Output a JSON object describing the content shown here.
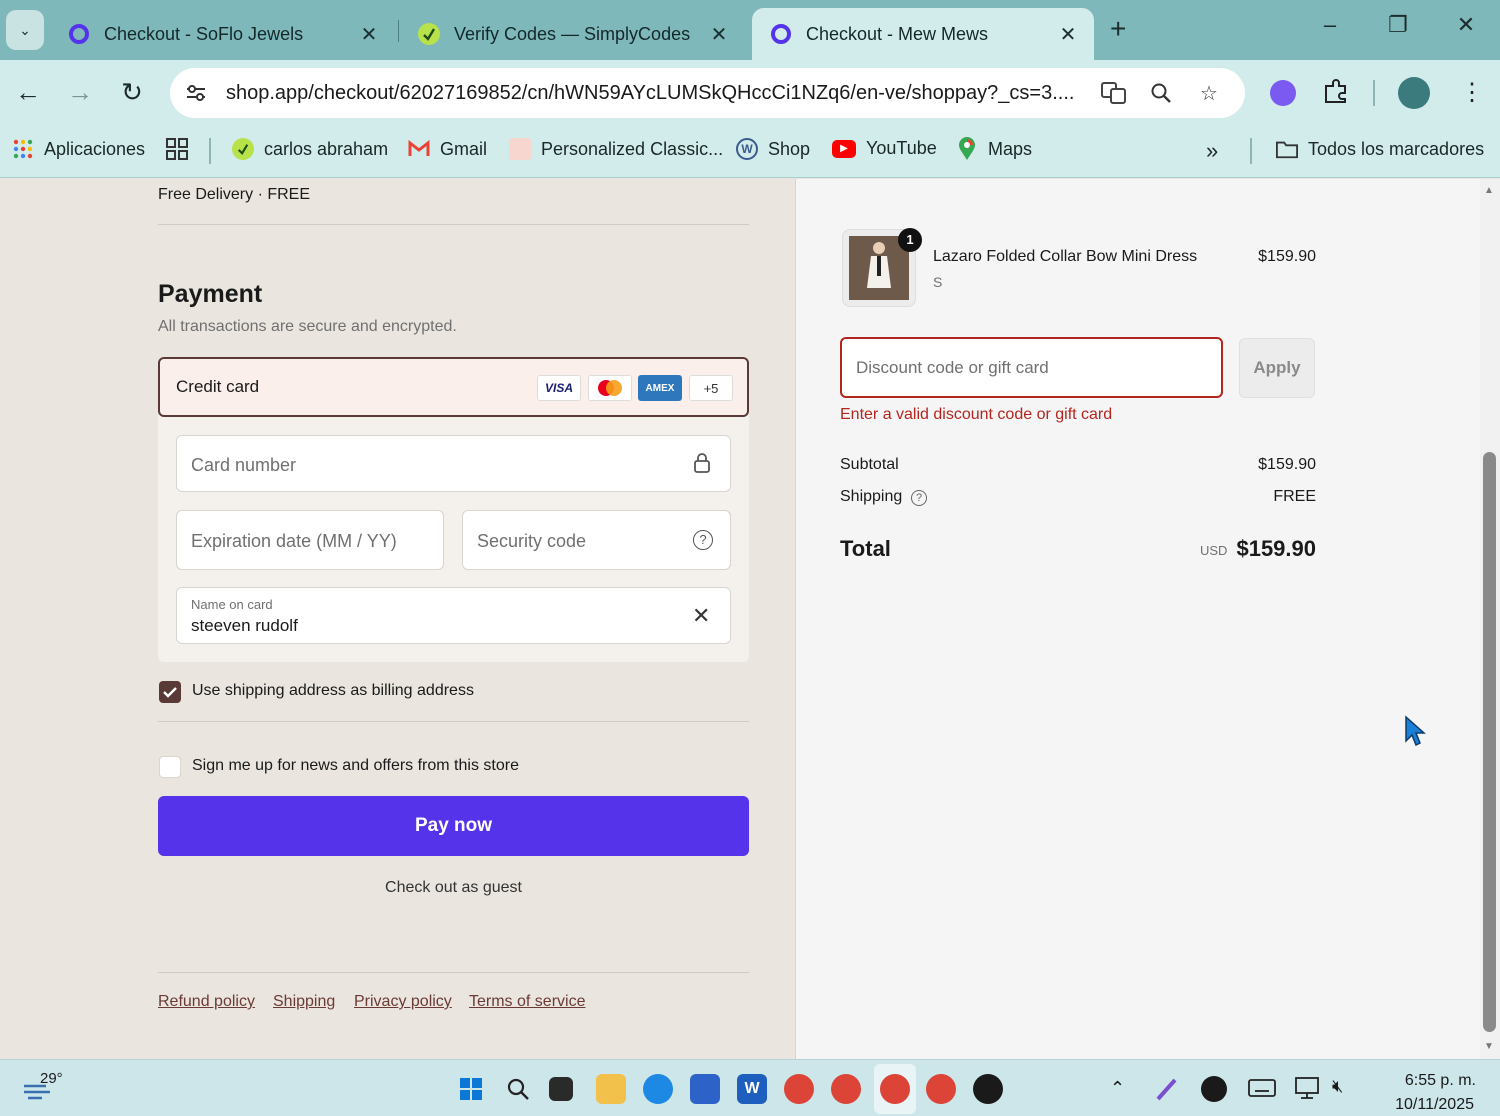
{
  "browser": {
    "tabs": [
      {
        "label": "Checkout - SoFlo Jewels",
        "close": "✕"
      },
      {
        "label": "Verify Codes — SimplyCodes",
        "close": "✕"
      },
      {
        "label": "Checkout - Mew Mews",
        "close": "✕"
      }
    ],
    "url": "shop.app/checkout/62027169852/cn/hWN59AYcLUMSkQHccCi1NZq6/en-ve/shoppay?_cs=3....",
    "bookmarks": [
      {
        "label": "Aplicaciones",
        "icon": "apps-grid-icon"
      },
      {
        "label": "carlos abraham",
        "icon": "simplycodes-icon"
      },
      {
        "label": "Gmail",
        "icon": "gmail-icon"
      },
      {
        "label": "Personalized Classic...",
        "icon": "page-icon"
      },
      {
        "label": "Shop",
        "icon": "wordpress-icon"
      },
      {
        "label": "YouTube",
        "icon": "youtube-icon"
      },
      {
        "label": "Maps",
        "icon": "maps-icon"
      }
    ],
    "all_bookmarks": "Todos los marcadores",
    "overflow": "»"
  },
  "checkout": {
    "delivery_line": "Free Delivery · FREE",
    "payment_title": "Payment",
    "payment_subtitle": "All transactions are secure and encrypted.",
    "credit_card_label": "Credit card",
    "card_brands": [
      "VISA",
      "AMEX",
      "+5"
    ],
    "card_number_placeholder": "Card number",
    "expiration_placeholder": "Expiration date (MM / YY)",
    "security_placeholder": "Security code",
    "name_label": "Name on card",
    "name_value": "steeven rudolf",
    "billing_checkbox_label": "Use shipping address as billing address",
    "billing_checked": true,
    "newsletter_label": "Sign me up for news and offers from this store",
    "newsletter_checked": false,
    "pay_button": "Pay now",
    "guest_link": "Check out as guest",
    "footer_links": [
      "Refund policy",
      "Shipping",
      "Privacy policy",
      "Terms of service"
    ]
  },
  "summary": {
    "product_name": "Lazaro Folded Collar Bow Mini Dress",
    "product_variant": "S",
    "product_qty": "1",
    "product_price": "$159.90",
    "discount_placeholder": "Discount code or gift card",
    "apply_button": "Apply",
    "discount_error": "Enter a valid discount code or gift card",
    "subtotal_label": "Subtotal",
    "subtotal_value": "$159.90",
    "shipping_label": "Shipping",
    "shipping_value": "FREE",
    "total_label": "Total",
    "total_currency": "USD",
    "total_value": "$159.90"
  },
  "taskbar": {
    "weather_temp": "29°",
    "time": "6:55 p. m.",
    "date": "10/11/2025"
  },
  "colors": {
    "accent": "#5433eb",
    "error": "#b3261e",
    "tab_strip": "#7fb8ba",
    "toolbar": "#d2ecec"
  }
}
